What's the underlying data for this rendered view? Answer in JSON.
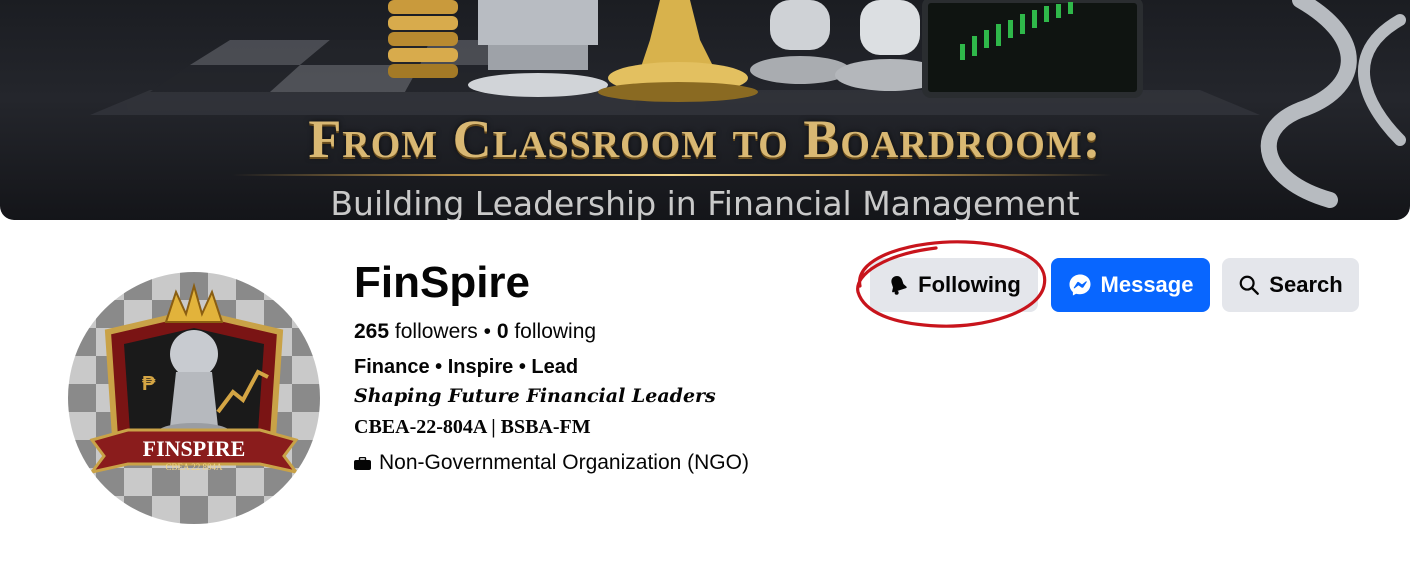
{
  "cover": {
    "title": "From Classroom to Boardroom:",
    "subtitle": "Building Leadership in Financial Management"
  },
  "page": {
    "name": "FinSpire",
    "followers": "265",
    "followers_label": "followers",
    "separator": "•",
    "following": "0",
    "following_label": "following",
    "tagline": "Finance • Inspire • Lead",
    "motto": "Shaping Future Financial Leaders",
    "codes": "CBEA-22-804A | BSBA-FM",
    "category": "Non-Governmental Organization (NGO)"
  },
  "avatar": {
    "banner_text": "FINSPIRE",
    "code_text": "CBEA 22 804A"
  },
  "actions": {
    "following_label": "Following",
    "message_label": "Message",
    "search_label": "Search"
  },
  "colors": {
    "primary": "#0866ff",
    "secondary_button": "#e4e6eb",
    "annotation": "#c8141c",
    "cover_gold": "#d9b873"
  },
  "icons": [
    "bell-icon",
    "messenger-icon",
    "search-icon",
    "briefcase-icon"
  ]
}
